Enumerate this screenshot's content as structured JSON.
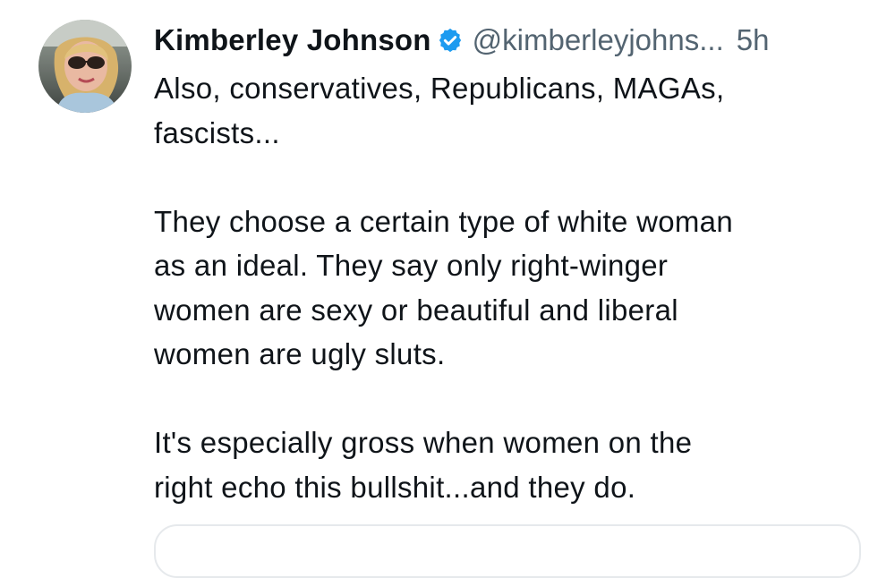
{
  "post": {
    "author_name": "Kimberley Johnson",
    "handle": "@kimberleyjohns...",
    "time": "5h",
    "paragraphs": [
      [
        "Also, conservatives, Republicans, MAGAs,",
        "fascists..."
      ],
      [
        "They choose a certain type of white woman",
        "as an ideal. They say only right-winger",
        "women are sexy or beautiful and liberal",
        "women are ugly sluts."
      ],
      [
        "It's especially gross when women on the",
        "right echo this bullshit...and they do."
      ]
    ]
  },
  "colors": {
    "text": "#0f1419",
    "muted": "#536471",
    "verified_badge": "#1d9bf0",
    "card_border": "#e6e9ec"
  },
  "icons": {
    "verified": "verified-badge-icon"
  }
}
